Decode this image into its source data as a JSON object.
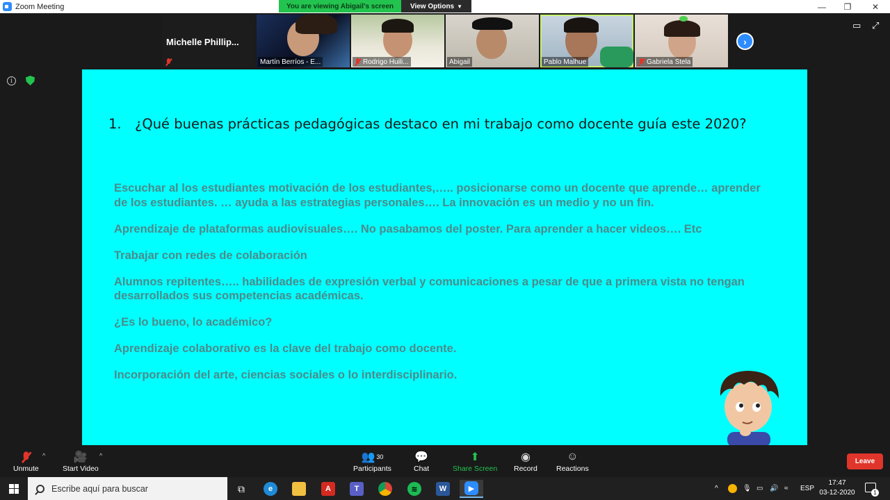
{
  "window": {
    "title": "Zoom Meeting",
    "viewing_banner": "You are viewing Abigail's screen",
    "view_options": "View Options",
    "minimize": "—",
    "maximize": "❐",
    "close": "✕"
  },
  "participants_strip": [
    {
      "name": "Michelle  Phillip...",
      "muted": true,
      "video": false
    },
    {
      "name": "Martín Berríos - E...",
      "muted": false,
      "video": true
    },
    {
      "name": "Rodrigo Huili...",
      "muted": true,
      "video": true
    },
    {
      "name": "Abigail",
      "muted": false,
      "video": true
    },
    {
      "name": "Pablo Malhue",
      "muted": false,
      "video": true,
      "active_speaker": true
    },
    {
      "name": "Gabriela Stela",
      "muted": true,
      "video": true
    }
  ],
  "slide": {
    "question_number": "1.",
    "question": "¿Qué buenas prácticas pedagógicas destaco en mi trabajo como docente guía este 2020?",
    "answers": [
      "Escuchar al los estudiantes motivación de los estudiantes,….. posicionarse como un docente que aprende… aprender de los estudiantes. … ayuda a las estrategias personales…. La innovación es un medio y no un fin.",
      "Aprendizaje de plataformas audiovisuales…. No pasabamos del poster. Para aprender a hacer videos…. Etc",
      "Trabajar con redes de colaboración",
      "Alumnos repitentes….. habilidades de expresión verbal y comunicaciones a pesar de que a primera vista no tengan desarrollados sus competencias académicas.",
      "¿Es lo bueno, lo académico?",
      "Aprendizaje colaborativo es la clave del trabajo como docente.",
      "Incorporación del arte, ciencias sociales o lo interdisciplinario."
    ]
  },
  "toolbar": {
    "unmute": "Unmute",
    "start_video": "Start Video",
    "participants": "Participants",
    "participants_count": "30",
    "chat": "Chat",
    "share_screen": "Share Screen",
    "record": "Record",
    "reactions": "Reactions",
    "leave": "Leave"
  },
  "taskbar": {
    "search_placeholder": "Escribe aquí para buscar",
    "language": "ESP",
    "time": "17:47",
    "date": "03-12-2020",
    "notification_count": "1"
  },
  "colors": {
    "slide_bg": "#00ffff",
    "answer_text": "#4a8c8c",
    "accent_green": "#23c34f",
    "leave_red": "#e0352b",
    "zoom_blue": "#2d8cff"
  }
}
